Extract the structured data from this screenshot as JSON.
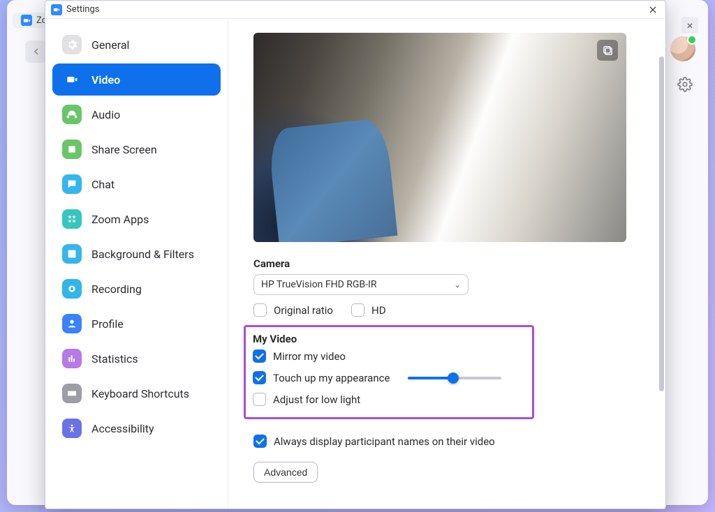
{
  "bg": {
    "tab_text": "Zoo",
    "close_glyph": "×"
  },
  "window": {
    "title": "Settings",
    "close_glyph": "×"
  },
  "sidebar": {
    "items": [
      {
        "id": "general",
        "label": "General",
        "icon_bg": "#e1e1e4",
        "icon": "gear",
        "icon_fill": "#ffffff",
        "active": false
      },
      {
        "id": "video",
        "label": "Video",
        "icon_bg": "#ffffff",
        "icon": "video",
        "icon_fill": "#ffffff",
        "active": true
      },
      {
        "id": "audio",
        "label": "Audio",
        "icon_bg": "#6ac569",
        "icon": "headphones",
        "icon_fill": "#ffffff",
        "active": false
      },
      {
        "id": "share",
        "label": "Share Screen",
        "icon_bg": "#6ac569",
        "icon": "share",
        "icon_fill": "#ffffff",
        "active": false
      },
      {
        "id": "chat",
        "label": "Chat",
        "icon_bg": "#35b6ea",
        "icon": "chat",
        "icon_fill": "#ffffff",
        "active": false
      },
      {
        "id": "apps",
        "label": "Zoom Apps",
        "icon_bg": "#35c6c0",
        "icon": "apps",
        "icon_fill": "#ffffff",
        "active": false
      },
      {
        "id": "bgf",
        "label": "Background & Filters",
        "icon_bg": "#35b6ea",
        "icon": "person-box",
        "icon_fill": "#ffffff",
        "active": false
      },
      {
        "id": "rec",
        "label": "Recording",
        "icon_bg": "#32b5e8",
        "icon": "record",
        "icon_fill": "#ffffff",
        "active": false
      },
      {
        "id": "profile",
        "label": "Profile",
        "icon_bg": "#3a82f7",
        "icon": "profile",
        "icon_fill": "#ffffff",
        "active": false
      },
      {
        "id": "stats",
        "label": "Statistics",
        "icon_bg": "#b57ae5",
        "icon": "stats",
        "icon_fill": "#ffffff",
        "active": false
      },
      {
        "id": "kbd",
        "label": "Keyboard Shortcuts",
        "icon_bg": "#9d9da6",
        "icon": "keyboard",
        "icon_fill": "#ffffff",
        "active": false
      },
      {
        "id": "a11y",
        "label": "Accessibility",
        "icon_bg": "#6a72e5",
        "icon": "a11y",
        "icon_fill": "#ffffff",
        "active": false
      }
    ]
  },
  "content": {
    "camera_label": "Camera",
    "camera_selected": "HP TrueVision FHD RGB-IR",
    "original_ratio": {
      "label": "Original ratio",
      "checked": false
    },
    "hd": {
      "label": "HD",
      "checked": false
    },
    "myvideo_label": "My Video",
    "mirror": {
      "label": "Mirror my video",
      "checked": true
    },
    "touchup": {
      "label": "Touch up my appearance",
      "checked": true,
      "slider_percent": 48
    },
    "lowlight": {
      "label": "Adjust for low light",
      "checked": false
    },
    "always_names": {
      "label": "Always display participant names on their video",
      "checked": true
    },
    "advanced_label": "Advanced"
  },
  "colors": {
    "accent": "#0e71eb",
    "highlight": "#a64fd5"
  }
}
